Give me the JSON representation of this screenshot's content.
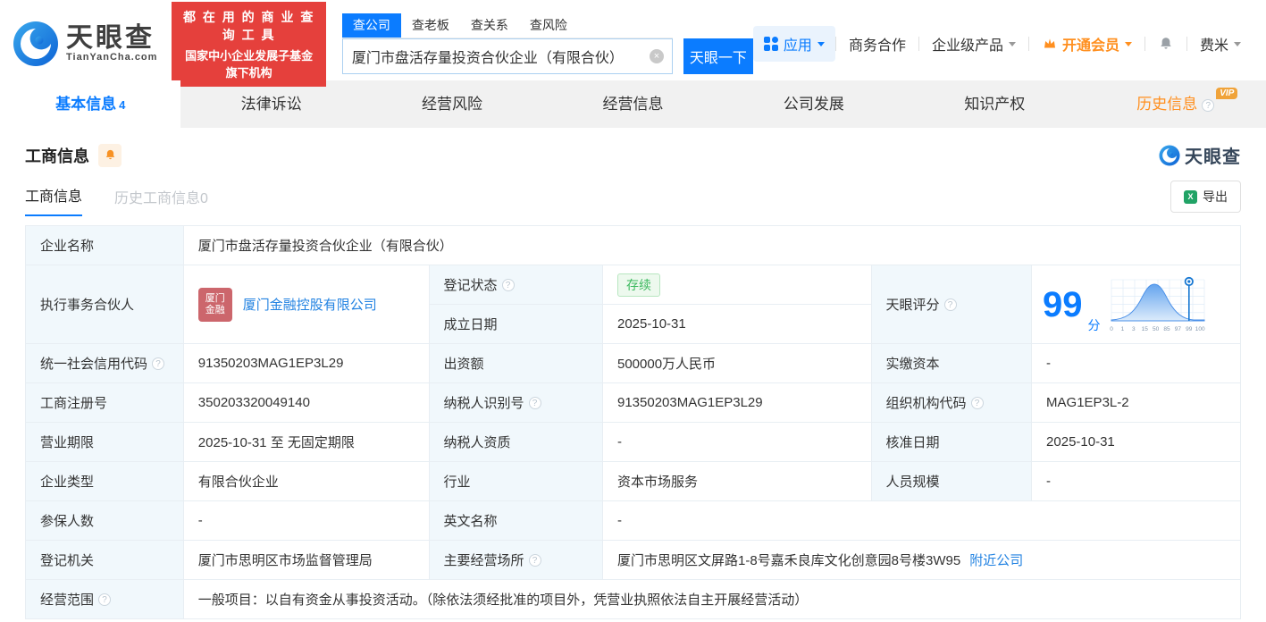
{
  "icons": {
    "help": "?",
    "clear": "×",
    "excel": "X"
  },
  "brand": {
    "name": "天眼查",
    "domain": "TianYanCha.com",
    "slogan_line1": "都 在 用 的 商 业 查 询 工 具",
    "slogan_line2": "国家中小企业发展子基金旗下机构"
  },
  "search": {
    "tabs": [
      "查公司",
      "查老板",
      "查关系",
      "查风险"
    ],
    "value": "厦门市盘活存量投资合伙企业（有限合伙）",
    "button": "天眼一下"
  },
  "menu": {
    "apps": "应用",
    "biz_coop": "商务合作",
    "enterprise": "企业级产品",
    "vip": "开通会员",
    "user": "费米"
  },
  "nav": {
    "tabs": [
      {
        "label": "基本信息",
        "count": "4"
      },
      {
        "label": "法律诉讼"
      },
      {
        "label": "经营风险"
      },
      {
        "label": "经营信息"
      },
      {
        "label": "公司发展"
      },
      {
        "label": "知识产权"
      },
      {
        "label": "历史信息",
        "vip": "VIP"
      }
    ]
  },
  "section": {
    "title": "工商信息",
    "subtab_active": "工商信息",
    "subtab_history": "历史工商信息0",
    "export": "导出",
    "watermark": "天眼查"
  },
  "biz": {
    "company_name": {
      "label": "企业名称",
      "value": "厦门市盘活存量投资合伙企业（有限合伙）"
    },
    "partner": {
      "label": "执行事务合伙人",
      "logo_line1": "厦门",
      "logo_line2": "金融",
      "name": "厦门金融控股有限公司"
    },
    "reg_status": {
      "label": "登记状态",
      "value": "存续"
    },
    "establish_date": {
      "label": "成立日期",
      "value": "2025-10-31"
    },
    "score": {
      "label": "天眼评分",
      "value": "99",
      "unit": "分",
      "axis_labels": [
        "0",
        "1",
        "3",
        "15",
        "50",
        "85",
        "97",
        "99",
        "100"
      ]
    },
    "credit_code": {
      "label": "统一社会信用代码",
      "value": "91350203MAG1EP3L29"
    },
    "capital": {
      "label": "出资额",
      "value": "500000万人民币"
    },
    "paid_capital": {
      "label": "实缴资本",
      "value": "-"
    },
    "reg_number": {
      "label": "工商注册号",
      "value": "350203320049140"
    },
    "taxpayer_id": {
      "label": "纳税人识别号",
      "value": "91350203MAG1EP3L29"
    },
    "org_code": {
      "label": "组织机构代码",
      "value": "MAG1EP3L-2"
    },
    "business_term": {
      "label": "营业期限",
      "value": "2025-10-31 至 无固定期限"
    },
    "taxpayer_quality": {
      "label": "纳税人资质",
      "value": "-"
    },
    "approval_date": {
      "label": "核准日期",
      "value": "2025-10-31"
    },
    "company_type": {
      "label": "企业类型",
      "value": "有限合伙企业"
    },
    "industry": {
      "label": "行业",
      "value": "资本市场服务"
    },
    "staff_size": {
      "label": "人员规模",
      "value": "-"
    },
    "insured_count": {
      "label": "参保人数",
      "value": "-"
    },
    "english_name": {
      "label": "英文名称",
      "value": "-"
    },
    "reg_authority": {
      "label": "登记机关",
      "value": "厦门市思明区市场监督管理局"
    },
    "address": {
      "label": "主要经营场所",
      "value": "厦门市思明区文屏路1-8号嘉禾良库文化创意园8号楼3W95",
      "link": "附近公司"
    },
    "scope": {
      "label": "经营范围",
      "value": "一般项目：以自有资金从事投资活动。（除依法须经批准的项目外，凭营业执照依法自主开展经营活动）"
    }
  }
}
